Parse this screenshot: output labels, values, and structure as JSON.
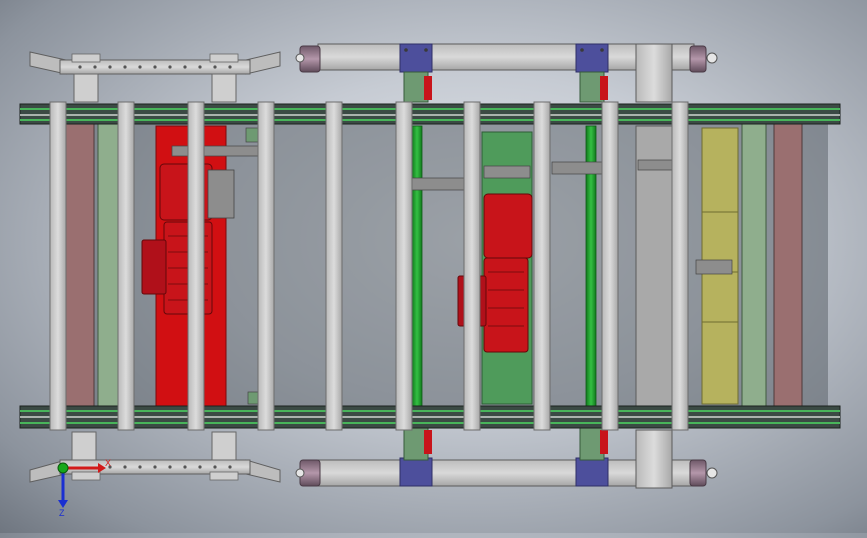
{
  "viewport": {
    "background_gradient": [
      "#e7eaef",
      "#c6cbd3",
      "#8c939d"
    ]
  },
  "triad": {
    "x_label": "X",
    "z_label": "Z",
    "x_color": "#d21a1a",
    "y_color": "#17a81a",
    "z_color": "#1a2fd2"
  },
  "colors": {
    "frame_steel": "#c9c9c9",
    "frame_edge": "#6d6d6d",
    "chain": "#3b4a44",
    "chain_highlight": "#48b45a",
    "motor_red": "#c8141a",
    "plate_red": "#d10f12",
    "plate_green": "#4f9b5b",
    "bar_green": "#1f9a2a",
    "plate_olive": "#b6b25e",
    "plate_mauve": "#9a6f70",
    "plate_sage": "#8fae8d",
    "bracket_blue": "#4d4f9c",
    "roller_purple": "#8c6f84",
    "block_gray": "#a9a9a9",
    "block_green": "#6e9a72"
  }
}
